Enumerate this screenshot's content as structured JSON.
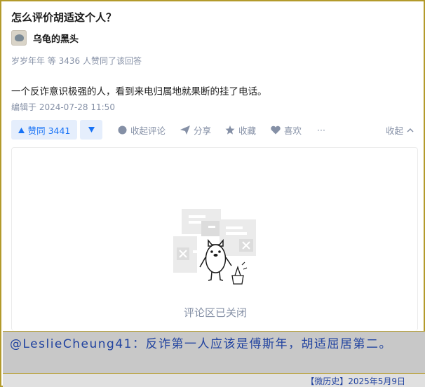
{
  "question": {
    "title": "怎么评价胡适这个人？"
  },
  "author": {
    "name": "乌龟的黑头"
  },
  "vote_summary": "岁岁年年 等 3436 人赞同了该回答",
  "answer": {
    "text": "一个反诈意识极强的人，看到来电归属地就果断的挂了电话。",
    "edit_time": "编辑于 2024-07-28 11:50"
  },
  "actions": {
    "upvote_label": "赞同 3441",
    "collapse_comments": "收起评论",
    "share": "分享",
    "favorite": "收藏",
    "like": "喜欢",
    "more": "···",
    "collapse": "收起"
  },
  "comments": {
    "closed_text": "评论区已关闭"
  },
  "caption": {
    "text": "@LeslieCheung41：反诈第一人应该是傅斯年，胡适屈居第二。"
  },
  "footer": {
    "source": "【微历史】2025年5月9日"
  },
  "colors": {
    "accent_blue": "#1772f6",
    "vote_bg": "#e5eefc",
    "muted": "#8590a6",
    "frame": "#b39a2b",
    "caption_blue": "#2143a0"
  }
}
